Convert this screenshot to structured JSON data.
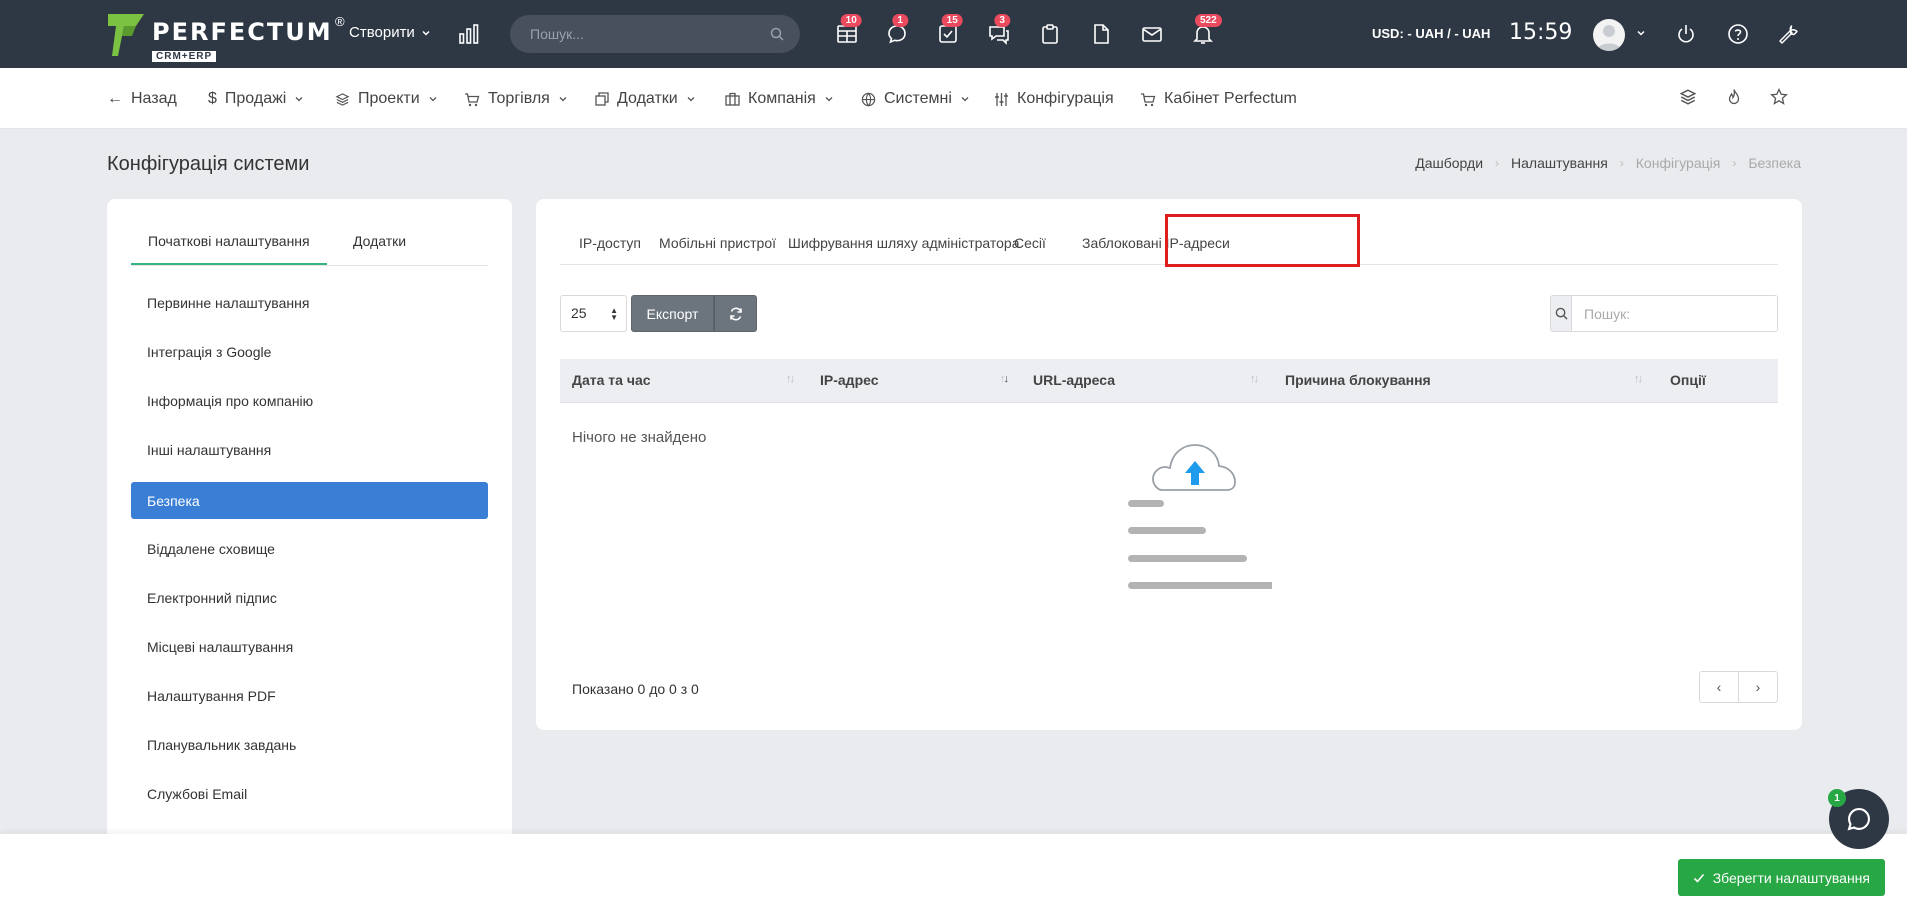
{
  "brand": {
    "name": "PERFECTUM",
    "registered": "®",
    "sub": "CRM+ERP"
  },
  "topbar": {
    "create_label": "Створити",
    "search_placeholder": "Пошук...",
    "badges": {
      "tasks_table": "10",
      "chat": "1",
      "checklist": "15",
      "comments": "3",
      "notifications": "522"
    },
    "currency": "USD: - UAH / - UAH",
    "time": "15:59"
  },
  "nav": {
    "back": "Назад",
    "sales": "Продажі",
    "projects": "Проекти",
    "trade": "Торгівля",
    "addons": "Додатки",
    "company": "Компанія",
    "system": "Системні",
    "config": "Конфігурація",
    "cabinet": "Кабінет Perfectum"
  },
  "page": {
    "title": "Конфігурація системи",
    "breadcrumb": [
      "Дашборди",
      "Налаштування",
      "Конфігурація",
      "Безпека"
    ]
  },
  "sidebar": {
    "tabs": [
      "Початкові налаштування",
      "Додатки"
    ],
    "items": [
      {
        "label": "Первинне налаштування"
      },
      {
        "label": "Інтеграція з Google"
      },
      {
        "label": "Інформація про компанію"
      },
      {
        "label": "Інші налаштування"
      },
      {
        "label": "Безпека"
      },
      {
        "label": "Віддалене сховище"
      },
      {
        "label": "Електронний підпис"
      },
      {
        "label": "Місцеві налаштування"
      },
      {
        "label": "Налаштування PDF"
      },
      {
        "label": "Планувальник завдань"
      },
      {
        "label": "Службові Email"
      }
    ]
  },
  "main": {
    "tabs": [
      "IP-доступ",
      "Мобільні пристрої",
      "Шифрування шляху адміністратора",
      "Сесії",
      "Заблоковані IP-адреси"
    ],
    "page_length": "25",
    "export_label": "Експорт",
    "search_placeholder": "Пошук:",
    "columns": [
      "Дата та час",
      "IP-адрес",
      "URL-адреса",
      "Причина блокування",
      "Опції"
    ],
    "empty_text": "Нічого не знайдено",
    "showing": "Показано 0 до 0 з 0",
    "prev": "‹",
    "next": "›"
  },
  "footer": {
    "save_label": "Зберегти налаштування",
    "chat_badge": "1"
  },
  "colors": {
    "topbar": "#2e3744",
    "accent_blue": "#3a7fd5",
    "badge_red": "#e94a5e",
    "success": "#28a745",
    "highlight": "#dc1e1e"
  }
}
